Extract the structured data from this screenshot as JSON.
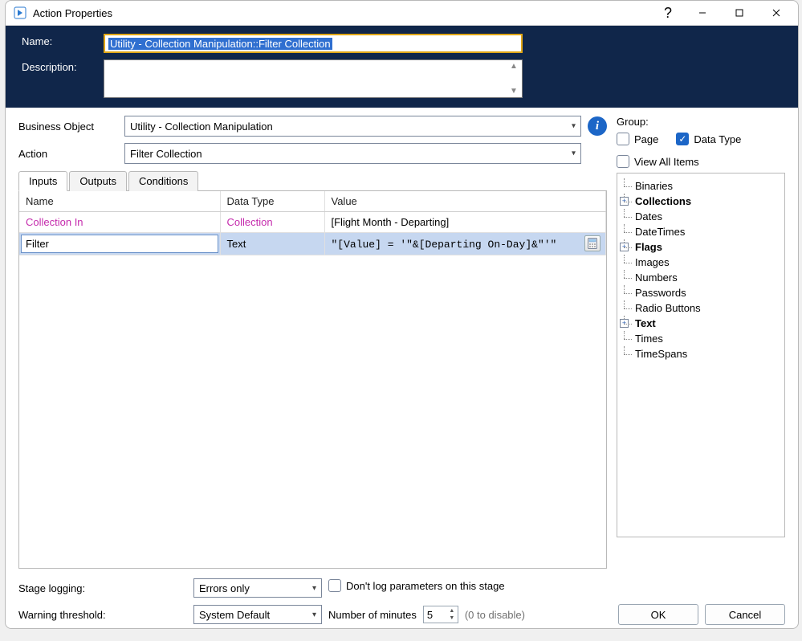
{
  "window": {
    "title": "Action Properties"
  },
  "header": {
    "name_label": "Name:",
    "name_value": "Utility - Collection Manipulation::Filter Collection",
    "desc_label": "Description:",
    "desc_value": ""
  },
  "selectors": {
    "business_object_label": "Business Object",
    "business_object_value": "Utility - Collection Manipulation",
    "action_label": "Action",
    "action_value": "Filter Collection"
  },
  "tabs": {
    "inputs": "Inputs",
    "outputs": "Outputs",
    "conditions": "Conditions"
  },
  "grid": {
    "headers": {
      "name": "Name",
      "datatype": "Data Type",
      "value": "Value"
    },
    "rows": [
      {
        "name": "Collection In",
        "datatype": "Collection",
        "value": "[Flight Month - Departing]",
        "link": true
      },
      {
        "name": "Filter",
        "datatype": "Text",
        "value": "\"[Value] = '\"&[Departing On-Day]&\"'\"",
        "selected": true,
        "mono": true
      }
    ]
  },
  "right": {
    "group_label": "Group:",
    "page_label": "Page",
    "datatype_label": "Data Type",
    "view_all_label": "View All Items",
    "tree": [
      {
        "label": "Binaries"
      },
      {
        "label": "Collections",
        "expandable": true,
        "bold": true
      },
      {
        "label": "Dates"
      },
      {
        "label": "DateTimes"
      },
      {
        "label": "Flags",
        "expandable": true,
        "bold": true
      },
      {
        "label": "Images"
      },
      {
        "label": "Numbers"
      },
      {
        "label": "Passwords"
      },
      {
        "label": "Radio Buttons"
      },
      {
        "label": "Text",
        "expandable": true,
        "bold": true
      },
      {
        "label": "Times"
      },
      {
        "label": "TimeSpans"
      }
    ]
  },
  "bottom": {
    "stage_logging_label": "Stage logging:",
    "stage_logging_value": "Errors only",
    "dont_log_label": "Don't log parameters on this stage",
    "warning_label": "Warning threshold:",
    "warning_value": "System Default",
    "minutes_label": "Number of minutes",
    "minutes_value": "5",
    "disable_hint": "(0 to disable)",
    "ok": "OK",
    "cancel": "Cancel"
  }
}
